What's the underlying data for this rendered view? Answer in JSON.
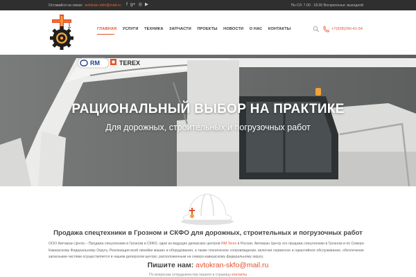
{
  "topbar": {
    "contact_prefix": "Оставайся на связи:",
    "email": "avtokran-skfo@mail.ru",
    "social_icons": [
      "facebook-icon",
      "google-plus-icon",
      "instagram-icon",
      "youtube-icon"
    ],
    "social_glyphs": [
      "f",
      "g+",
      "◎",
      "▶"
    ],
    "hours": "Пн-Сб: 7.00 - 18.00 Воскресенье: выходной"
  },
  "nav": {
    "items": [
      "ГЛАВНАЯ",
      "УСЛУГИ",
      "ТЕХНИКА",
      "ЗАПЧАСТИ",
      "ПРОЕКТЫ",
      "НОВОСТИ",
      "О НАС",
      "КОНТАКТЫ"
    ],
    "active_index": 0
  },
  "header": {
    "phone": "+7(928)290-41-54"
  },
  "hero": {
    "brand_rm": "RM",
    "brand_terex": "TEREX",
    "title": "РАЦИОНАЛЬНЫЙ ВЫБОР НА ПРАКТИКЕ",
    "subtitle": "Для дорожных, строительных и погрузочных работ"
  },
  "content": {
    "heading": "Продажа спецтехники в Грозном и СКФО для дорожных, строительных и погрузочных работ",
    "paragraph_before": "ООО Автокран Центр – Продажа спецтехники в Грозном и СКФО, одни из ведущих дилерских центров ",
    "paragraph_highlight": "RM Terex",
    "paragraph_after": " в России. Автокран Центр это продажа спецтехники в Грозном и по Северо-Кавказскому Федеральному Округу. Реализация всей линейки машин и оборудования, а также техническое сопровождение, включая сервисное и гарантийное обслуживание, обеспечение запасными частями осуществляется в нашем дилерском центре, расположенным на северо-кавказскому федеральному округу.",
    "write_label": "Пишите нам:",
    "write_email": "avtokran-skfo@mail.ru",
    "cut_text": "По вопросам сотрудничества пишите в страницу",
    "cut_link": "контакты"
  },
  "colors": {
    "accent": "#e5502a",
    "topbar_bg": "#2f2f2f",
    "hero_bg": "#6d6f6f"
  }
}
